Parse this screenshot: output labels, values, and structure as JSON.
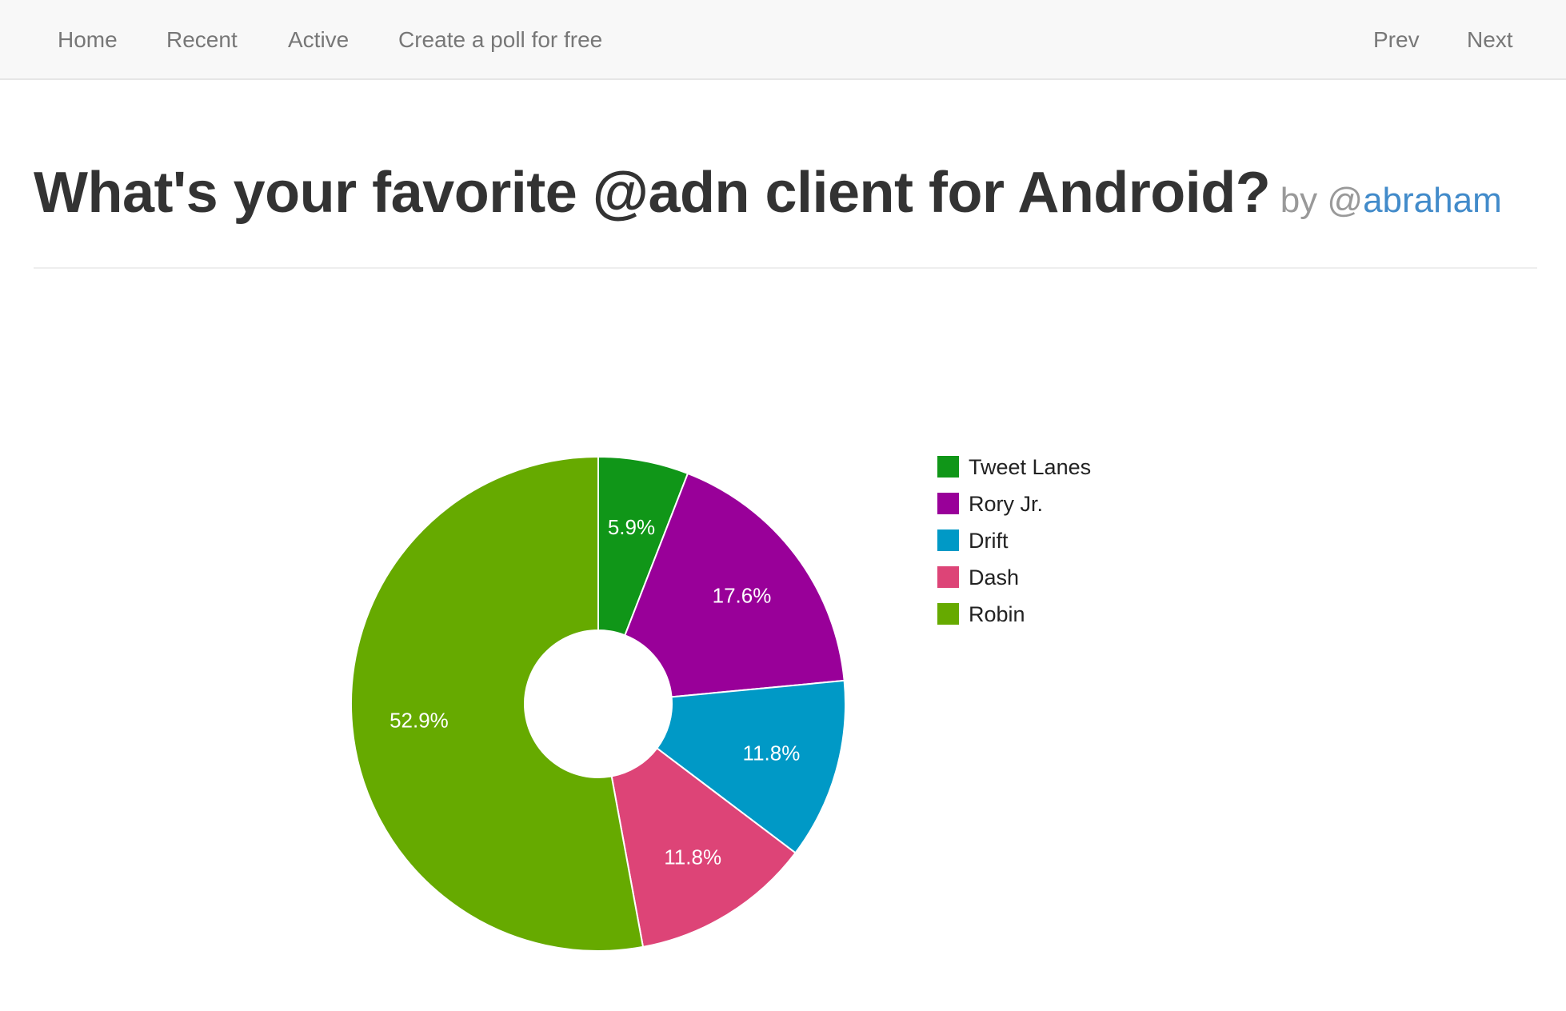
{
  "nav": {
    "home": "Home",
    "recent": "Recent",
    "active": "Active",
    "create": "Create a poll for free",
    "prev": "Prev",
    "next": "Next"
  },
  "poll": {
    "question": "What's your favorite @adn client for Android?",
    "by": "by @",
    "author": "abraham"
  },
  "chart_data": {
    "type": "pie",
    "donut": true,
    "legend_position": "right",
    "slices": [
      {
        "label": "Tweet Lanes",
        "percent": 5.9,
        "display": "5.9%",
        "color": "#109618"
      },
      {
        "label": "Rory Jr.",
        "percent": 17.6,
        "display": "17.6%",
        "color": "#990099"
      },
      {
        "label": "Drift",
        "percent": 11.8,
        "display": "11.8%",
        "color": "#0099c6"
      },
      {
        "label": "Dash",
        "percent": 11.8,
        "display": "11.8%",
        "color": "#dd4477"
      },
      {
        "label": "Robin",
        "percent": 52.9,
        "display": "52.9%",
        "color": "#66aa00"
      }
    ]
  }
}
